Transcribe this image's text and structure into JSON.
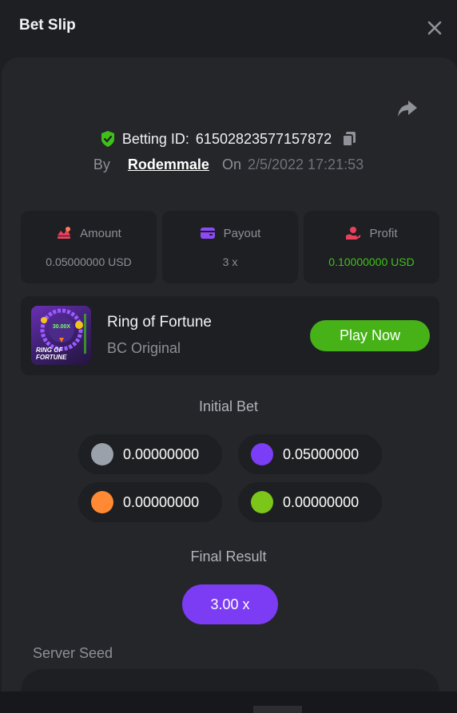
{
  "header": {
    "title": "Bet Slip"
  },
  "bet": {
    "id_label": "Betting ID:",
    "id": "61502823577157872",
    "by_label": "By",
    "user": "Rodemmale",
    "on_label": "On",
    "date": "2/5/2022 17:21:53"
  },
  "stats": {
    "amount": {
      "label": "Amount",
      "value": "0.05000000 USD"
    },
    "payout": {
      "label": "Payout",
      "value": "3 x"
    },
    "profit": {
      "label": "Profit",
      "value": "0.10000000 USD"
    }
  },
  "game": {
    "name": "Ring of Fortune",
    "provider": "BC Original",
    "play_label": "Play Now",
    "thumb_badge": "30.00X",
    "thumb_title_1": "RING OF",
    "thumb_title_2": "FORTUNE"
  },
  "initial_bet": {
    "title": "Initial Bet",
    "chips": [
      {
        "color": "#9aa1ab",
        "amount": "0.00000000"
      },
      {
        "color": "#7b3df5",
        "amount": "0.05000000"
      },
      {
        "color": "#ff8a33",
        "amount": "0.00000000"
      },
      {
        "color": "#7bc618",
        "amount": "0.00000000"
      }
    ]
  },
  "final_result": {
    "title": "Final Result",
    "value": "3.00 x"
  },
  "server_seed": {
    "label": "Server Seed"
  },
  "colors": {
    "profit_green": "#3fc018",
    "play_green": "#46b218",
    "result_purple": "#7c3cf3",
    "verified_green": "#3fc018"
  }
}
